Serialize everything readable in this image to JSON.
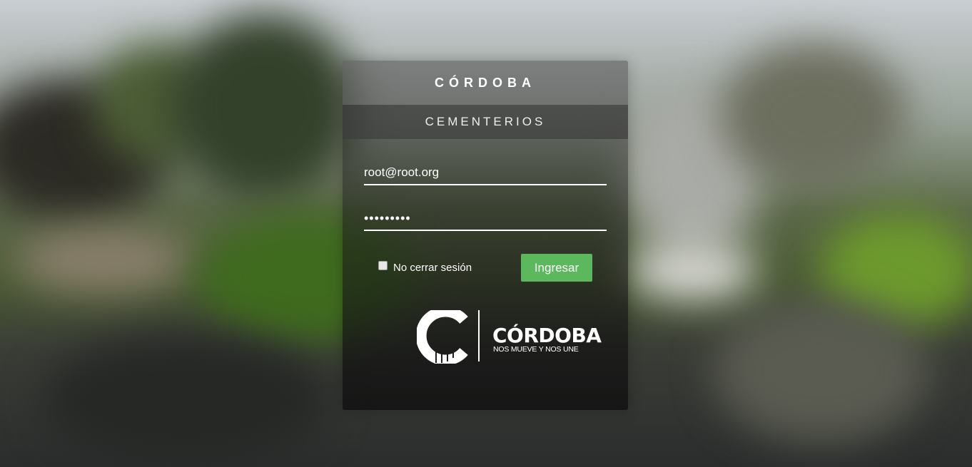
{
  "header": {
    "title": "CÓRDOBA",
    "subtitle": "CEMENTERIOS"
  },
  "form": {
    "email_value": "root@root.org",
    "password_value": "•••••••••",
    "remember_label": "No cerrar sesión",
    "remember_checked": false,
    "submit_label": "Ingresar"
  },
  "logo": {
    "wordmark": "CÓRDOBA",
    "tagline": "NOS MUEVE Y NOS UNE"
  },
  "colors": {
    "submit_button": "#5cb85c",
    "text": "#ffffff"
  }
}
